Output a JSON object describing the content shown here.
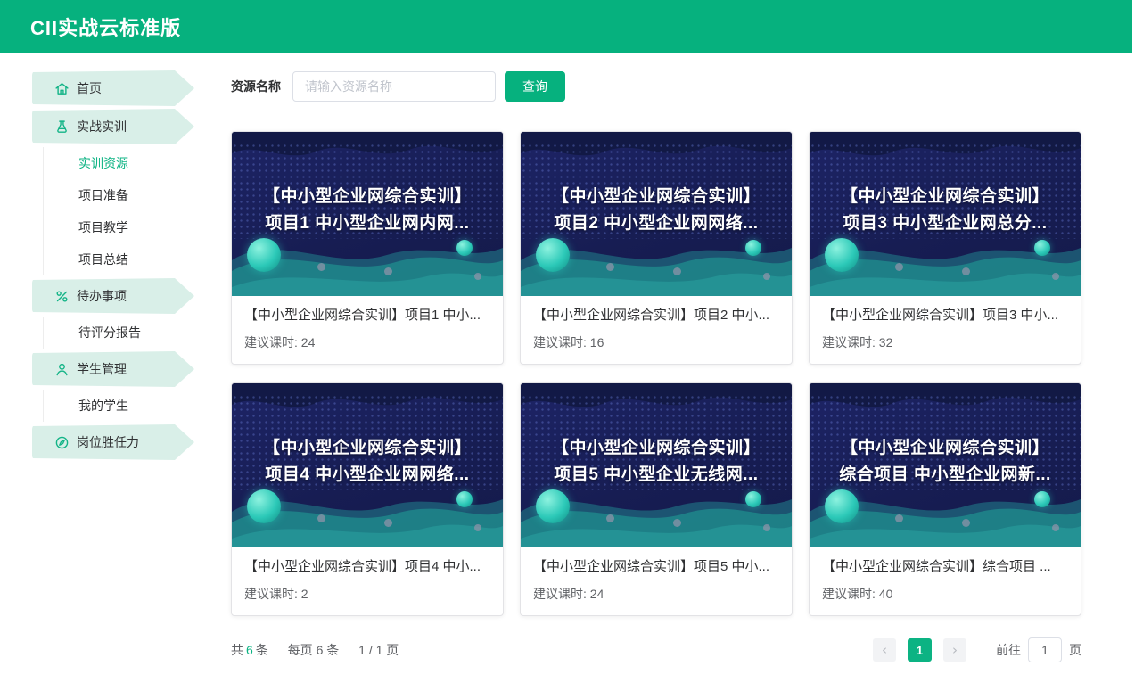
{
  "header": {
    "title": "CII实战云标准版"
  },
  "colors": {
    "primary": "#06b17e",
    "banner_bg": "#d9efe8",
    "card_image_bg": "#1a2158"
  },
  "sidebar": {
    "items": [
      {
        "label": "首页",
        "icon": "home-icon"
      },
      {
        "label": "实战实训",
        "icon": "flask-icon"
      },
      {
        "label": "实训资源",
        "active": true
      },
      {
        "label": "项目准备"
      },
      {
        "label": "项目教学"
      },
      {
        "label": "项目总结"
      },
      {
        "label": "待办事项",
        "icon": "percent-icon"
      },
      {
        "label": "待评分报告"
      },
      {
        "label": "学生管理",
        "icon": "user-icon"
      },
      {
        "label": "我的学生"
      },
      {
        "label": "岗位胜任力",
        "icon": "compass-icon"
      }
    ]
  },
  "search": {
    "label": "资源名称",
    "placeholder": "请输入资源名称",
    "button_label": "查询"
  },
  "cards": [
    {
      "overlay_line1": "【中小型企业网综合实训】",
      "overlay_line2": "项目1 中小型企业网内网...",
      "title": "【中小型企业网综合实训】项目1 中小...",
      "hours_label": "建议课时:",
      "hours_value": "24"
    },
    {
      "overlay_line1": "【中小型企业网综合实训】",
      "overlay_line2": "项目2 中小型企业网网络...",
      "title": "【中小型企业网综合实训】项目2 中小...",
      "hours_label": "建议课时:",
      "hours_value": "16"
    },
    {
      "overlay_line1": "【中小型企业网综合实训】",
      "overlay_line2": "项目3 中小型企业网总分...",
      "title": "【中小型企业网综合实训】项目3 中小...",
      "hours_label": "建议课时:",
      "hours_value": "32"
    },
    {
      "overlay_line1": "【中小型企业网综合实训】",
      "overlay_line2": "项目4 中小型企业网网络...",
      "title": "【中小型企业网综合实训】项目4 中小...",
      "hours_label": "建议课时:",
      "hours_value": "2"
    },
    {
      "overlay_line1": "【中小型企业网综合实训】",
      "overlay_line2": "项目5 中小型企业无线网...",
      "title": "【中小型企业网综合实训】项目5 中小...",
      "hours_label": "建议课时:",
      "hours_value": "24"
    },
    {
      "overlay_line1": "【中小型企业网综合实训】",
      "overlay_line2": "综合项目 中小型企业网新...",
      "title": "【中小型企业网综合实训】综合项目 ...",
      "hours_label": "建议课时:",
      "hours_value": "40"
    }
  ],
  "pagination": {
    "total_prefix": "共",
    "total_value": "6",
    "total_suffix": "条",
    "per_page": "每页 6 条",
    "page_ratio": "1 / 1 页",
    "prev_icon": "‹",
    "current_page": "1",
    "next_icon": "›",
    "goto_label": "前往",
    "goto_value": "1",
    "goto_suffix": "页"
  }
}
